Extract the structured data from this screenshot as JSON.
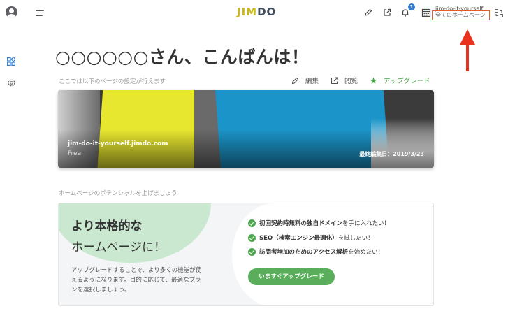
{
  "header": {
    "logo": {
      "prefix": "JIM",
      "suffix": "DO"
    },
    "notification_count": "1",
    "site_url": "jim-do-it-yourself.jimdo.com",
    "all_pages_label": "全てのホームページ"
  },
  "greeting": "○○○○○○さん、こんばんは！",
  "subtext": "ここでは以下のページの設定が行えます",
  "actions": {
    "edit": "編集",
    "view": "閲覧",
    "upgrade": "アップグレード"
  },
  "site_card": {
    "domain": "jim-do-it-yourself.jimdo.com",
    "plan": "Free",
    "last_edited": "最終編集日：2019/3/23"
  },
  "potential_label": "ホームページのポテンシャルを上げましょう",
  "promo": {
    "title_line1": "より本格的な",
    "title_line2": "ホームページに！",
    "description": "アップグレードすることで、より多くの機能が使えるようになります。目的に応じて、最適なプランを選択しましょう。",
    "features": [
      {
        "bold": "初回契約時無料の独自ドメイン",
        "rest": " を手に入れたい！"
      },
      {
        "bold": "SEO（検索エンジン最適化）",
        "rest": " を試したい！"
      },
      {
        "bold": "訪問者増加のためのアクセス解析",
        "rest": " を始めたい！"
      }
    ],
    "cta_label": "いますぐアップグレード"
  },
  "colors": {
    "accent_green": "#5aad5b",
    "annotation_red": "#e8321e",
    "logo_yellow": "#c9b81d",
    "badge_blue": "#2d7fd8"
  }
}
